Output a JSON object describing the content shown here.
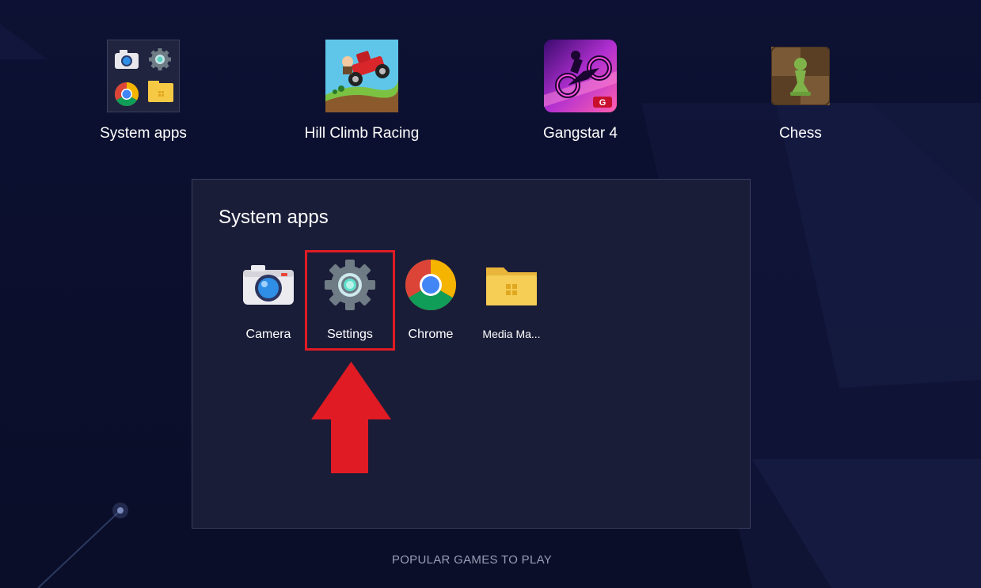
{
  "desktop": {
    "apps": [
      {
        "label": "System apps",
        "icon": "system-apps-folder-icon"
      },
      {
        "label": "Hill Climb Racing",
        "icon": "hill-climb-racing-icon"
      },
      {
        "label": "Gangstar 4",
        "icon": "gangstar-4-icon"
      },
      {
        "label": "Chess",
        "icon": "chess-icon"
      }
    ]
  },
  "folder": {
    "title": "System apps",
    "apps": [
      {
        "label": "Camera",
        "icon": "camera-icon"
      },
      {
        "label": "Settings",
        "icon": "gear-icon",
        "highlighted": true
      },
      {
        "label": "Chrome",
        "icon": "chrome-icon"
      },
      {
        "label": "Media Ma...",
        "icon": "media-manager-folder-icon"
      }
    ]
  },
  "footer": {
    "popular_games": "POPULAR GAMES TO PLAY"
  },
  "colors": {
    "background": "#0c1030",
    "panel": "#1a1d38",
    "highlight": "#e01b24",
    "arrow": "#e01b24"
  }
}
